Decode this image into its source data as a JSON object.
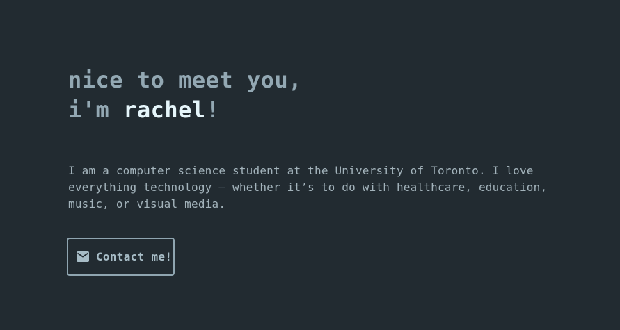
{
  "hero": {
    "greeting": "nice to meet you,",
    "intro_prefix": "i'm ",
    "name": "rachel",
    "exclaim": "!",
    "bio": "I am a computer science student at the University of Toronto. I love everything technology — whether it’s to do with healthcare, education, music, or visual media."
  },
  "contact": {
    "label": "Contact me!",
    "icon": "mail-icon"
  },
  "colors": {
    "background": "#222b31",
    "heading": "#93a8b3",
    "name_highlight": "#e6f6fb",
    "body_text": "#a3b3bb",
    "button_border": "#8fa5b0"
  }
}
